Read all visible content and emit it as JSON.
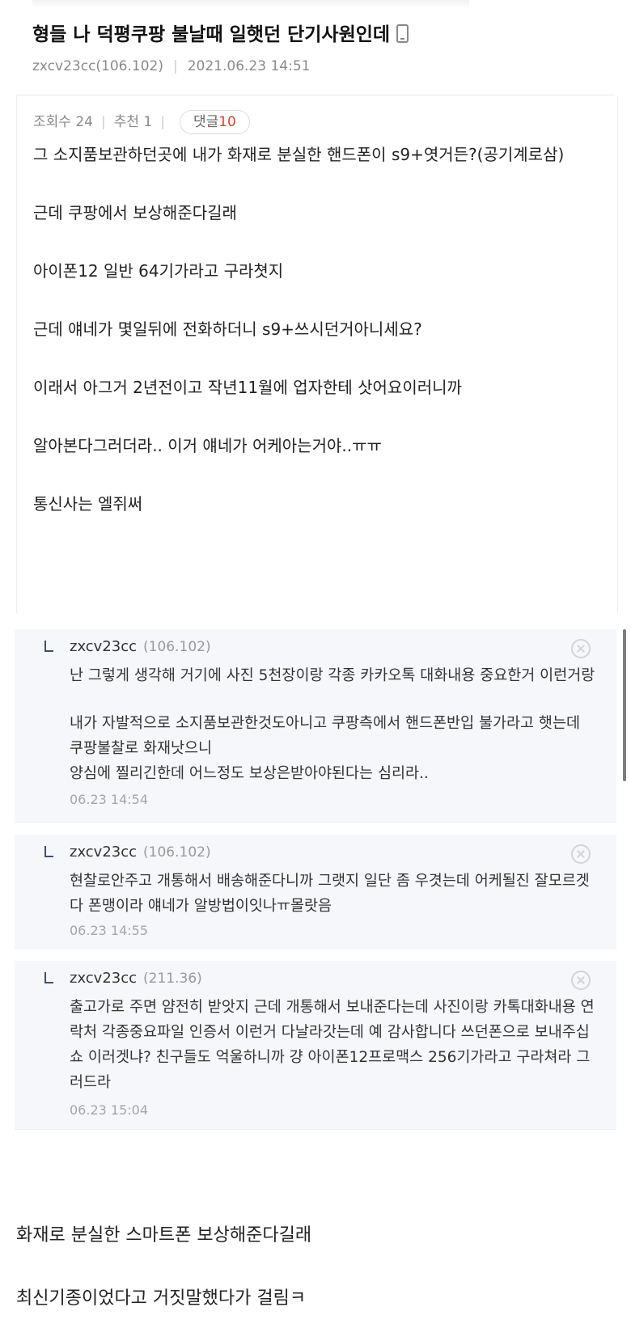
{
  "post": {
    "title": "형들 나 덕평쿠팡 불날때 일햇던 단기사원인데",
    "author": "zxcv23cc(106.102)",
    "datetime": "2021.06.23 14:51",
    "views_label": "조회수 24",
    "likes_label": "추천 1",
    "comments_label": "댓글",
    "comments_count": "10",
    "body": [
      "그 소지품보관하던곳에 내가 화재로 분실한 핸드폰이 s9+엿거든?(공기계로삼)",
      "근데 쿠팡에서 보상해준다길래",
      "아이폰12 일반 64기가라고 구라쳣지",
      "근데 얘네가 몇일뒤에 전화하더니 s9+쓰시던거아니세요?",
      "이래서 아그거 2년전이고 작년11월에 업자한테 삿어요이러니까",
      "알아본다그러더라.. 이거 얘네가 어케아는거야..ㅠㅠ",
      "통신사는 엘쥐써"
    ]
  },
  "comments": [
    {
      "author": "zxcv23cc",
      "ip": "(106.102)",
      "lines": [
        "난 그렇게 생각해 거기에 사진 5천장이랑 각종 카카오톡 대화내용 중요한거 이런거랑",
        "",
        "내가 자발적으로 소지품보관한것도아니고 쿠팡측에서 핸드폰반입 불가라고 햇는데 쿠팡불찰로 화재낫으니",
        "양심에 찔리긴한데 어느정도 보상은받아야된다는 심리라.."
      ],
      "time": "06.23 14:54"
    },
    {
      "author": "zxcv23cc",
      "ip": "(106.102)",
      "lines": [
        "현찰로안주고 개통해서 배송해준다니까 그랫지 일단 좀 우겻는데 어케될진 잘모르겟다 폰맹이라 얘네가 알방법이잇나ㅠ몰랏음"
      ],
      "time": "06.23 14:55"
    },
    {
      "author": "zxcv23cc",
      "ip": "(211.36)",
      "lines": [
        "출고가로 주면 얌전히 받앗지 근데 개통해서 보내준다는데 사진이랑 카톡대화내용 연락처 각종중요파일 인증서 이런거 다날라갓는데 예 감사합니다 쓰던폰으로 보내주십쇼 이러겟냐? 친구들도 억울하니까 걍 아이폰12프로맥스 256기가라고 구라쳐라 그러드라"
      ],
      "time": "06.23 15:04"
    }
  ],
  "captions": [
    "화재로 분실한 스마트폰 보상해준다길래",
    "최신기종이었다고 거짓말했다가 걸림ㅋ"
  ],
  "colors": {
    "accent_red": "#d9452f",
    "comment_bg": "#f5f7fa",
    "muted_text": "#8a8a8a"
  },
  "icons": {
    "phone": "phone-icon",
    "reply": "reply-arrow-icon",
    "delete": "close-icon"
  }
}
